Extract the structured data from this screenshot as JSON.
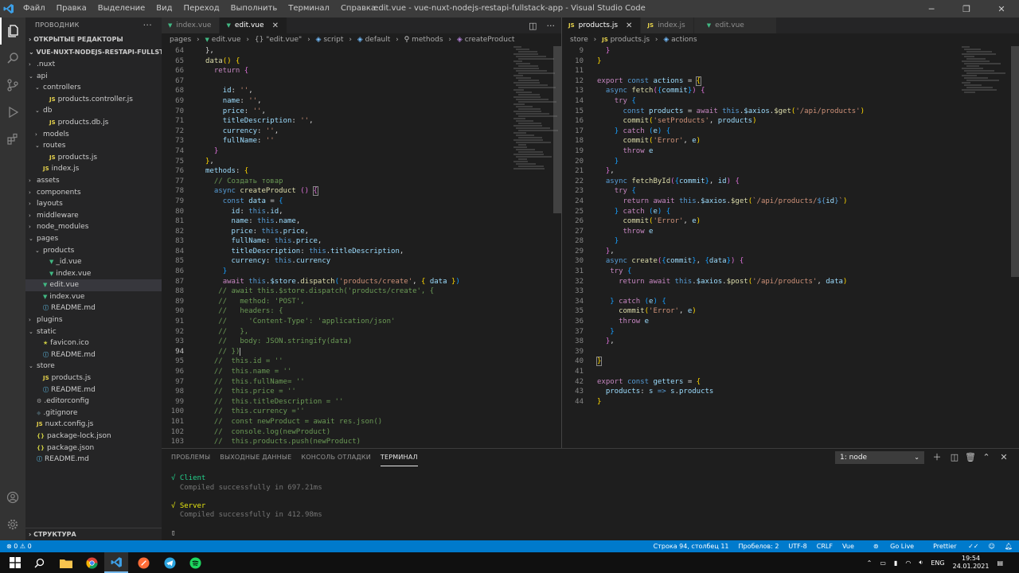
{
  "title_bar": {
    "menu": [
      "Файл",
      "Правка",
      "Выделение",
      "Вид",
      "Переход",
      "Выполнить",
      "Терминал",
      "Справка"
    ],
    "window_title": "edit.vue - vue-nuxt-nodejs-restapi-fullstack-app - Visual Studio Code"
  },
  "sidebar": {
    "header": "ПРОВОДНИК",
    "open_editors": "ОТКРЫТЫЕ РЕДАКТОРЫ",
    "project": "VUE-NUXT-NODEJS-RESTAPI-FULLSTACK-A...",
    "outline": "СТРУКТУРА",
    "tree": [
      {
        "label": ".nuxt",
        "depth": 1,
        "kind": "folder",
        "open": false
      },
      {
        "label": "api",
        "depth": 1,
        "kind": "folder",
        "open": true
      },
      {
        "label": "controllers",
        "depth": 2,
        "kind": "folder",
        "open": true
      },
      {
        "label": "products.controller.js",
        "depth": 3,
        "kind": "js"
      },
      {
        "label": "db",
        "depth": 2,
        "kind": "folder",
        "open": true
      },
      {
        "label": "products.db.js",
        "depth": 3,
        "kind": "js"
      },
      {
        "label": "models",
        "depth": 2,
        "kind": "folder",
        "open": false
      },
      {
        "label": "routes",
        "depth": 2,
        "kind": "folder",
        "open": true
      },
      {
        "label": "products.js",
        "depth": 3,
        "kind": "js"
      },
      {
        "label": "index.js",
        "depth": 2,
        "kind": "js"
      },
      {
        "label": "assets",
        "depth": 1,
        "kind": "folder",
        "open": false
      },
      {
        "label": "components",
        "depth": 1,
        "kind": "folder",
        "open": false
      },
      {
        "label": "layouts",
        "depth": 1,
        "kind": "folder",
        "open": false
      },
      {
        "label": "middleware",
        "depth": 1,
        "kind": "folder",
        "open": false
      },
      {
        "label": "node_modules",
        "depth": 1,
        "kind": "folder",
        "open": false
      },
      {
        "label": "pages",
        "depth": 1,
        "kind": "folder",
        "open": true
      },
      {
        "label": "products",
        "depth": 2,
        "kind": "folder",
        "open": true
      },
      {
        "label": "_id.vue",
        "depth": 3,
        "kind": "vue"
      },
      {
        "label": "index.vue",
        "depth": 3,
        "kind": "vue"
      },
      {
        "label": "edit.vue",
        "depth": 2,
        "kind": "vue",
        "selected": true
      },
      {
        "label": "index.vue",
        "depth": 2,
        "kind": "vue"
      },
      {
        "label": "README.md",
        "depth": 2,
        "kind": "md"
      },
      {
        "label": "plugins",
        "depth": 1,
        "kind": "folder",
        "open": false
      },
      {
        "label": "static",
        "depth": 1,
        "kind": "folder",
        "open": true
      },
      {
        "label": "favicon.ico",
        "depth": 2,
        "kind": "ico"
      },
      {
        "label": "README.md",
        "depth": 2,
        "kind": "md"
      },
      {
        "label": "store",
        "depth": 1,
        "kind": "folder",
        "open": true
      },
      {
        "label": "products.js",
        "depth": 2,
        "kind": "js"
      },
      {
        "label": "README.md",
        "depth": 2,
        "kind": "md"
      },
      {
        "label": ".editorconfig",
        "depth": 1,
        "kind": "cfg"
      },
      {
        "label": ".gitignore",
        "depth": 1,
        "kind": "git"
      },
      {
        "label": "nuxt.config.js",
        "depth": 1,
        "kind": "js"
      },
      {
        "label": "package-lock.json",
        "depth": 1,
        "kind": "json"
      },
      {
        "label": "package.json",
        "depth": 1,
        "kind": "json"
      },
      {
        "label": "README.md",
        "depth": 1,
        "kind": "md"
      }
    ]
  },
  "left_editor": {
    "tabs": [
      {
        "label": "index.vue",
        "active": false
      },
      {
        "label": "edit.vue",
        "active": true
      }
    ],
    "breadcrumb": [
      "pages",
      "edit.vue",
      "{} \"edit.vue\"",
      "script",
      "default",
      "methods",
      "createProduct"
    ],
    "first_line": 64,
    "current_line": 94
  },
  "right_editor": {
    "tabs": [
      {
        "label": "products.js",
        "active": true
      },
      {
        "label": "index.js",
        "active": false
      },
      {
        "label": "edit.vue",
        "active": false
      }
    ],
    "breadcrumb": [
      "store",
      "products.js",
      "actions"
    ],
    "first_line": 9
  },
  "panel": {
    "tabs": [
      "ПРОБЛЕМЫ",
      "ВЫХОДНЫЕ ДАННЫЕ",
      "КОНСОЛЬ ОТЛАДКИ",
      "ТЕРМИНАЛ"
    ],
    "active_tab": "ТЕРМИНАЛ",
    "terminal_select": "1: node",
    "terminal_lines": [
      {
        "text": "√ Client",
        "color": "green"
      },
      {
        "text": "  Compiled successfully in 697.21ms",
        "color": "gray"
      },
      {
        "text": "",
        "color": "gray"
      },
      {
        "text": "√ Server",
        "color": "yellow"
      },
      {
        "text": "  Compiled successfully in 412.98ms",
        "color": "gray"
      },
      {
        "text": "",
        "color": "gray"
      },
      {
        "text": "▯",
        "color": "white"
      }
    ]
  },
  "status_bar": {
    "problems": "⊗ 0 ⚠ 0",
    "cursor": "Строка 94, столбец 11",
    "spaces": "Пробелов: 2",
    "encoding": "UTF-8",
    "eol": "CRLF",
    "language": "Vue",
    "golive": "Go Live",
    "prettier": "Prettier"
  },
  "taskbar": {
    "lang": "ENG",
    "time": "19:54",
    "date": "24.01.2021"
  },
  "colors": {
    "accent": "#007acc",
    "js_icon": "#e8d44d",
    "vue_icon": "#41b883",
    "md_icon": "#519aba",
    "json_icon": "#cbcb41"
  }
}
